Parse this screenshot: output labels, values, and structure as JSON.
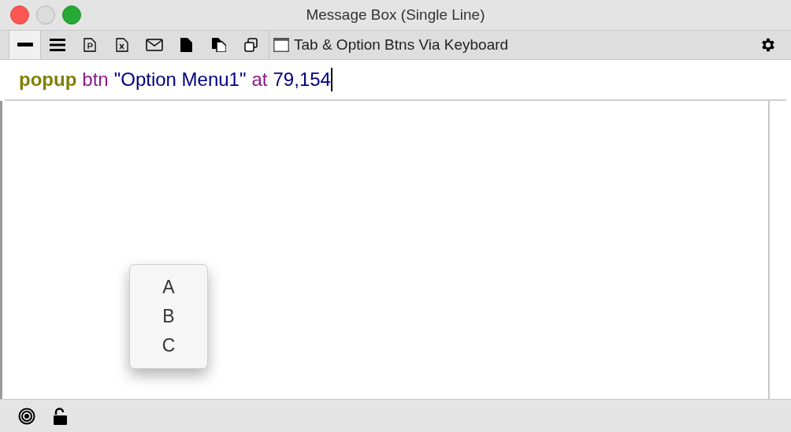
{
  "window": {
    "title": "Message Box (Single Line)"
  },
  "toolbar": {
    "tools": [
      {
        "selected": true
      },
      {
        "selected": false
      },
      {
        "selected": false
      },
      {
        "selected": false
      },
      {
        "selected": false
      },
      {
        "selected": false
      },
      {
        "selected": false
      },
      {
        "selected": false
      }
    ],
    "stack_name": "Tab & Option Btns Via Keyboard"
  },
  "message_line": {
    "tokens": [
      {
        "kind": "keyword",
        "text": "popup"
      },
      {
        "kind": "object",
        "text": "btn"
      },
      {
        "kind": "string",
        "text": "\"Option Menu1\""
      },
      {
        "kind": "object",
        "text": "at"
      },
      {
        "kind": "number",
        "text": "79,154"
      }
    ]
  },
  "popup_menu": {
    "items": [
      "A",
      "B",
      "C"
    ]
  }
}
